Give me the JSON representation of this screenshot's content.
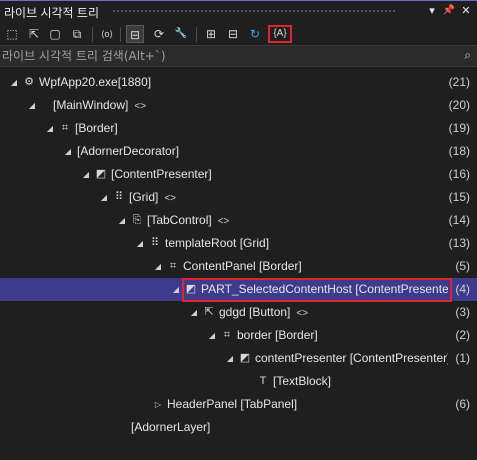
{
  "window": {
    "title": "라이브 시각적 트리",
    "pin": "▾",
    "pin2": "📌",
    "close": "✕"
  },
  "toolbar": {
    "items": [
      {
        "name": "select-element-icon",
        "glyph": "⬚"
      },
      {
        "name": "select-pointer-icon",
        "glyph": "⇱"
      },
      {
        "name": "display-layout-adorner-icon",
        "glyph": "▢"
      },
      {
        "name": "track-focus-icon",
        "glyph": "⧉"
      },
      {
        "name": "show-runtime-tools-icon",
        "glyph": "⟨o⟩"
      },
      {
        "name": "hot-reload-icon",
        "glyph": "⊟"
      },
      {
        "name": "refresh-icon",
        "glyph": "⟳"
      },
      {
        "name": "wrench-icon",
        "glyph": "🔧"
      },
      {
        "name": "expand-all-icon",
        "glyph": "⊞"
      },
      {
        "name": "collapse-all-icon",
        "glyph": "⊟"
      },
      {
        "name": "sync-icon",
        "glyph": "↻"
      },
      {
        "name": "show-properties-icon",
        "glyph": "{A}"
      }
    ]
  },
  "search": {
    "placeholder": "라이브 시각적 트리 검색(Alt+`)"
  },
  "tree": [
    {
      "depth": 0,
      "arrow": "◢",
      "icon": "⚙",
      "label": "WpfApp20.exe[1880]",
      "count": "(21)",
      "preview": false
    },
    {
      "depth": 1,
      "arrow": "◢",
      "icon": "",
      "label": "[MainWindow]",
      "count": "(20)",
      "preview": true
    },
    {
      "depth": 2,
      "arrow": "◢",
      "icon": "⌗",
      "label": "[Border]",
      "count": "(19)",
      "preview": false
    },
    {
      "depth": 3,
      "arrow": "◢",
      "icon": "",
      "label": "[AdornerDecorator]",
      "count": "(18)",
      "preview": false
    },
    {
      "depth": 4,
      "arrow": "◢",
      "icon": "◩",
      "label": "[ContentPresenter]",
      "count": "(16)",
      "preview": false
    },
    {
      "depth": 5,
      "arrow": "◢",
      "icon": "⠿",
      "label": "[Grid]",
      "count": "(15)",
      "preview": true
    },
    {
      "depth": 6,
      "arrow": "◢",
      "icon": "⎘",
      "label": "[TabControl]",
      "count": "(14)",
      "preview": true
    },
    {
      "depth": 7,
      "arrow": "◢",
      "icon": "⠿",
      "label": "templateRoot [Grid]",
      "count": "(13)",
      "preview": false
    },
    {
      "depth": 8,
      "arrow": "◢",
      "icon": "⌗",
      "label": "ContentPanel [Border]",
      "count": "(5)",
      "preview": false
    },
    {
      "depth": 9,
      "arrow": "◢",
      "icon": "◩",
      "label": "PART_SelectedContentHost [ContentPresenter]",
      "count": "(4)",
      "preview": false,
      "selected": true
    },
    {
      "depth": 10,
      "arrow": "◢",
      "icon": "⇱",
      "label": "gdgd [Button]",
      "count": "(3)",
      "preview": true
    },
    {
      "depth": 11,
      "arrow": "◢",
      "icon": "⌗",
      "label": "border [Border]",
      "count": "(2)",
      "preview": false
    },
    {
      "depth": 12,
      "arrow": "◢",
      "icon": "◩",
      "label": "contentPresenter [ContentPresenter]",
      "count": "(1)",
      "preview": false
    },
    {
      "depth": 13,
      "arrow": "",
      "icon": "T",
      "label": "[TextBlock]",
      "count": "",
      "preview": false
    },
    {
      "depth": 8,
      "arrow": "▷",
      "icon": "",
      "label": "HeaderPanel [TabPanel]",
      "count": "(6)",
      "preview": false
    },
    {
      "depth": 6,
      "arrow": "",
      "icon": "",
      "label": "[AdornerLayer]",
      "count": "",
      "preview": false
    }
  ]
}
